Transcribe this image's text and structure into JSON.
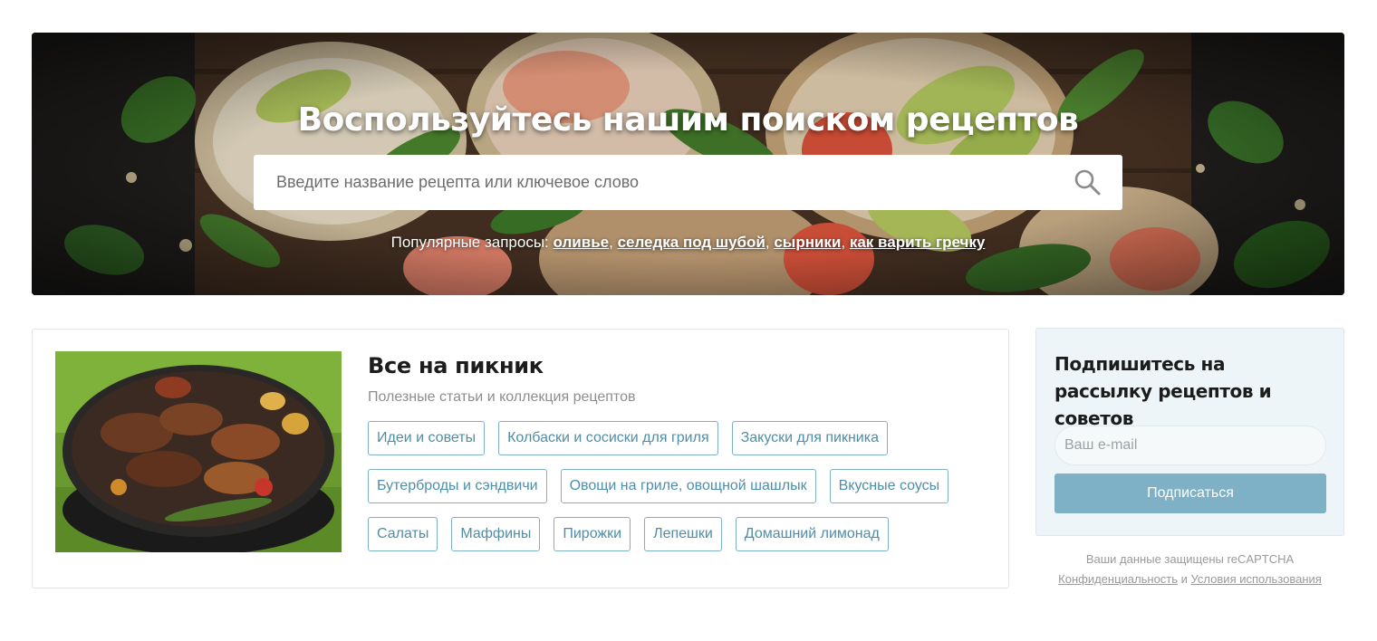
{
  "hero": {
    "title": "Воспользуйтесь нашим поиском рецептов",
    "search_placeholder": "Введите название рецепта или ключевое слово",
    "popular_label": "Популярные запросы:",
    "popular_links": [
      "оливье",
      "селедка под шубой",
      "сырники",
      "как варить гречку"
    ]
  },
  "picnic": {
    "title": "Все на пикник",
    "subtitle": "Полезные статьи и коллекция рецептов",
    "tag_rows": [
      [
        "Идеи и советы",
        "Колбаски и сосиски для гриля",
        "Закуски для пикника"
      ],
      [
        "Бутерброды и сэндвичи",
        "Овощи на гриле, овощной шашлык",
        "Вкусные соусы"
      ],
      [
        "Салаты",
        "Маффины",
        "Пирожки",
        "Лепешки",
        "Домашний лимонад"
      ]
    ]
  },
  "subscribe": {
    "title": "Подпишитесь на рассылку рецептов и советов",
    "email_placeholder": "Ваш e-mail",
    "button_label": "Подписаться",
    "captcha_text": "Ваши данные защищены reCAPTCHA",
    "privacy_link": "Конфиденциальность",
    "and": "и",
    "terms_link": "Условия использования"
  },
  "colors": {
    "accent": "#7eb0c6",
    "tag_text": "#4f8ea8",
    "tag_border": "#7fb1c5",
    "panel_bg": "#eef5f8"
  },
  "icons": [
    "search-icon"
  ]
}
